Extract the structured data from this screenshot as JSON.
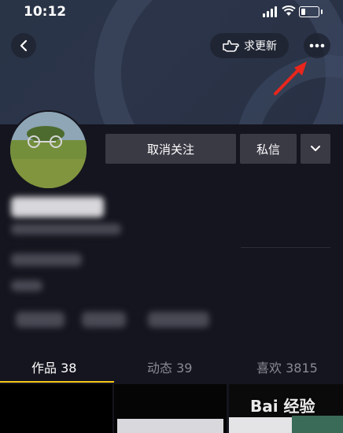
{
  "status_bar": {
    "time": "10:12"
  },
  "header": {
    "update_label": "求更新"
  },
  "profile": {
    "unfollow_label": "取消关注",
    "message_label": "私信"
  },
  "tabs": [
    {
      "label": "作品 38"
    },
    {
      "label": "动态 39"
    },
    {
      "label": "喜欢 3815"
    }
  ],
  "watermark": {
    "text": "Bai 经验"
  },
  "colors": {
    "accent": "#f5c518",
    "annotation": "#e8261c"
  }
}
